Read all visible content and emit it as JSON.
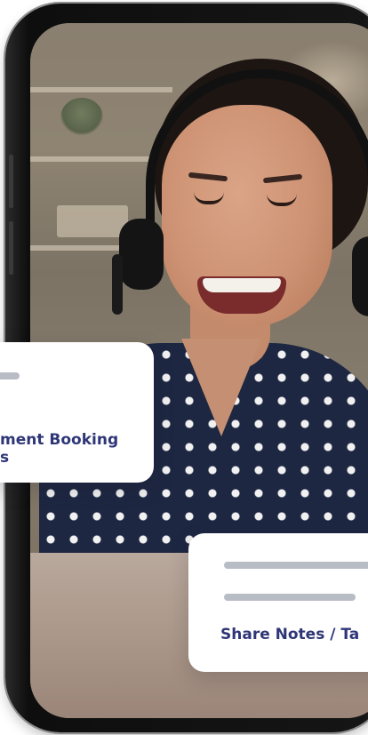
{
  "cards": {
    "appointment": {
      "title_line1": "ment Booking",
      "title_line2": "s"
    },
    "notes": {
      "title": "Share Notes / Ta"
    }
  },
  "colors": {
    "card_text": "#2e3677",
    "card_bar": "#b8bcc5",
    "phone_frame": "#151515",
    "shirt": "#1e2742"
  },
  "icons": [
    "headset-icon"
  ]
}
